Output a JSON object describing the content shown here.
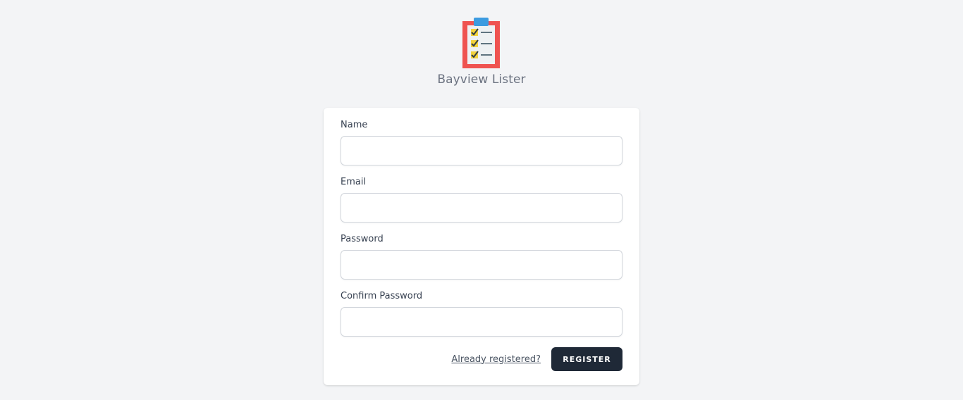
{
  "app": {
    "logo_icon": "clipboard-checklist-icon",
    "name": "Bayview Lister"
  },
  "form": {
    "fields": [
      {
        "label": "Name",
        "value": "",
        "placeholder": ""
      },
      {
        "label": "Email",
        "value": "",
        "placeholder": ""
      },
      {
        "label": "Password",
        "value": "",
        "placeholder": ""
      },
      {
        "label": "Confirm Password",
        "value": "",
        "placeholder": ""
      }
    ],
    "login_link": "Already registered?",
    "submit_label": "Register"
  },
  "colors": {
    "background": "#f3f4f6",
    "button": "#1f2937",
    "logo_border": "#ef5350",
    "logo_clip": "#3c9be0",
    "logo_check_box": "#f2d23c"
  }
}
